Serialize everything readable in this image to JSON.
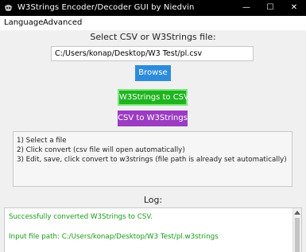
{
  "window": {
    "title": "W3Strings Encoder/Decoder GUI by Niedvin",
    "minimize_glyph": "—",
    "maximize_glyph": "☐",
    "close_glyph": "✕"
  },
  "menu": {
    "items": [
      "Language",
      "Advanced"
    ]
  },
  "file_section": {
    "heading": "Select CSV or W3Strings file:",
    "path_value": "C:/Users/konap/Desktop/W3 Test/pl.csv",
    "browse_label": "Browse"
  },
  "actions": {
    "to_csv_label": "W3Strings to CSV",
    "to_w3strings_label": "CSV to W3Strings",
    "to_csv_color": "#1fb41f",
    "to_w3strings_color": "#9b3cc2",
    "browse_color": "#2d8bdb"
  },
  "instructions": [
    "1) Select a file",
    "2) Click convert (csv file will open automatically)",
    "3) Edit, save, click convert to w3strings (file path is already set automatically)"
  ],
  "log": {
    "heading": "Log:",
    "lines": [
      "Successfully converted W3Strings to CSV.",
      "Input file path: C:/Users/konap/Desktop/W3 Test/pl.w3strings"
    ],
    "text_color": "#1a9a1a"
  }
}
